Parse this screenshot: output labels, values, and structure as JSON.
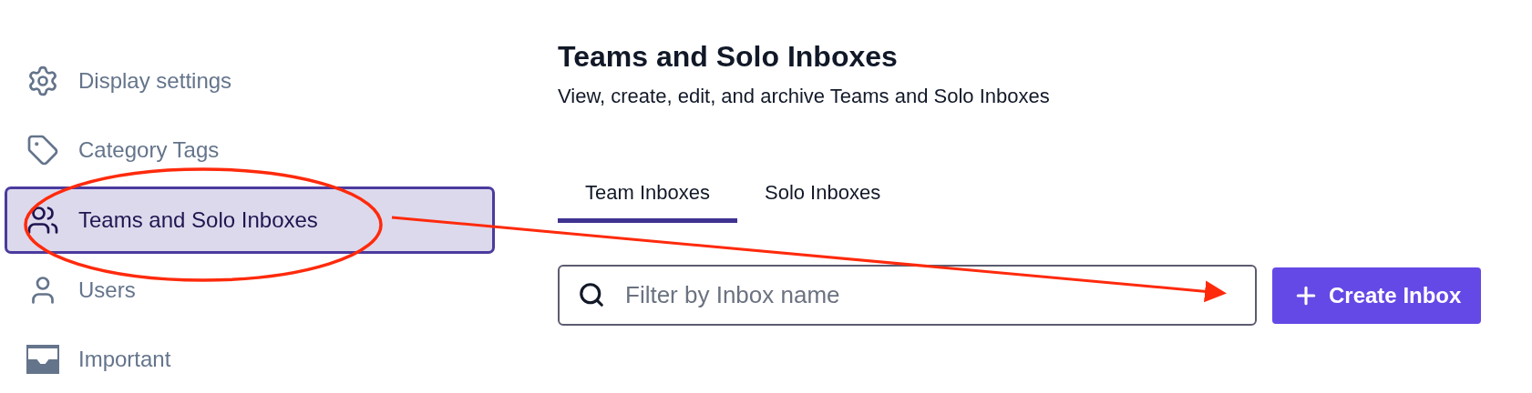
{
  "sidebar": {
    "items": [
      {
        "label": "Display settings",
        "selected": false
      },
      {
        "label": "Category Tags",
        "selected": false
      },
      {
        "label": "Teams and Solo Inboxes",
        "selected": true
      },
      {
        "label": "Users",
        "selected": false
      },
      {
        "label": "Important",
        "selected": false
      }
    ]
  },
  "main": {
    "title": "Teams and Solo Inboxes",
    "subtitle": "View, create, edit, and archive Teams and Solo Inboxes",
    "tabs": [
      {
        "label": "Team Inboxes",
        "selected": true
      },
      {
        "label": "Solo Inboxes",
        "selected": false
      }
    ],
    "search": {
      "placeholder": "Filter by Inbox name"
    },
    "create_button": {
      "label": "Create Inbox"
    }
  }
}
